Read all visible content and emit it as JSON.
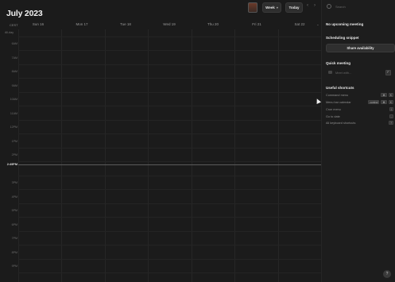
{
  "header": {
    "title": "July 2023",
    "view_label": "Week",
    "today_label": "Today",
    "prev_icon": "chevron-left-icon",
    "next_icon": "chevron-right-icon"
  },
  "timezone": "CEST",
  "all_day_label": "All-day",
  "days": [
    "Sun 16",
    "Mon 17",
    "Tue 18",
    "Wed 19",
    "Thu 20",
    "Fri 21",
    "Sat 22"
  ],
  "hours": [
    "6AM",
    "7AM",
    "8AM",
    "9AM",
    "10AM",
    "11AM",
    "12PM",
    "1PM",
    "2PM",
    "3PM",
    "4PM",
    "5PM",
    "6PM",
    "7PM",
    "8PM",
    "9PM"
  ],
  "now_label": "2:49PM",
  "sidebar": {
    "search_placeholder": "Search",
    "upcoming_title": "No upcoming meeting",
    "snippet_title": "Scheduling snippet",
    "share_label": "Share availability",
    "quick_title": "Quick meeting",
    "quick_placeholder": "Meet with...",
    "quick_key": "F",
    "shortcuts_title": "Useful shortcuts",
    "shortcuts": [
      {
        "label": "Command menu",
        "keys": [
          "⌘",
          "K"
        ]
      },
      {
        "label": "Menu bar calendar",
        "keys": [
          "control",
          "⌘",
          "K"
        ]
      },
      {
        "label": "Cron menu",
        "keys": [
          "/"
        ]
      },
      {
        "label": "Go to date",
        "keys": [
          "."
        ]
      },
      {
        "label": "All keyboard shortcuts",
        "keys": [
          "?"
        ]
      }
    ],
    "help_label": "?"
  }
}
